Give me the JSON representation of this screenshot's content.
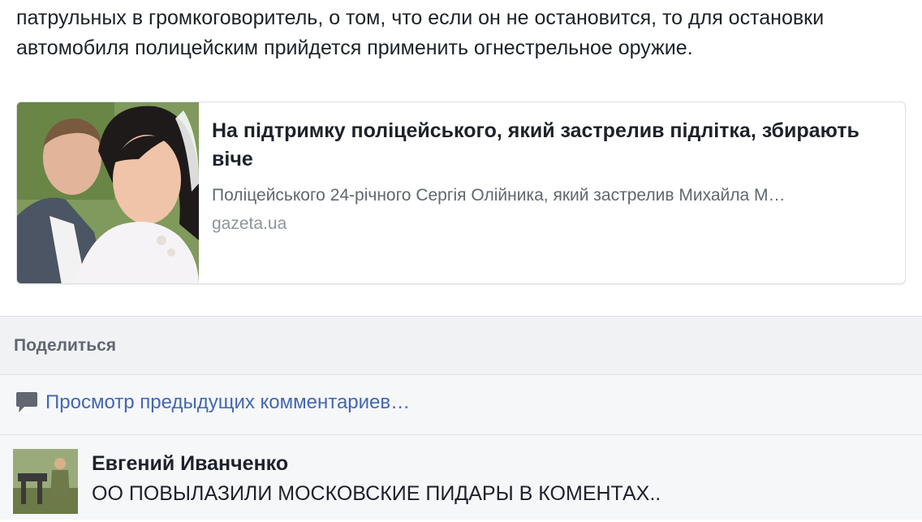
{
  "post": {
    "text": "патрульных в громкоговоритель, о том, что если он не остановится, то для остановки автомобиля полицейским прийдется применить огнестрельное оружие."
  },
  "link_preview": {
    "title": "На підтримку поліцейського, який застрелив підлітка, збирають віче",
    "description": "Поліцейського 24-річного Сергія Олійника, який застрелив Михайла М…",
    "domain": "gazeta.ua",
    "thumbnail_icon": "wedding-photo"
  },
  "actions": {
    "share_label": "Поделиться"
  },
  "comments": {
    "view_previous_label": "Просмотр предыдущих комментариев…",
    "view_previous_icon": "comment-bubble-icon",
    "items": [
      {
        "author": "Евгений Иванченко",
        "text": "ОО ПОВЫЛАЗИЛИ МОСКОВСКИЕ ПИДАРЫ В КОМЕНТАХ..",
        "avatar_icon": "user-avatar"
      }
    ]
  },
  "colors": {
    "link_blue": "#4267b2",
    "text_primary": "#1d2129",
    "text_secondary": "#606770",
    "text_muted": "#90949c",
    "bar_bg": "#f1f2f4"
  }
}
